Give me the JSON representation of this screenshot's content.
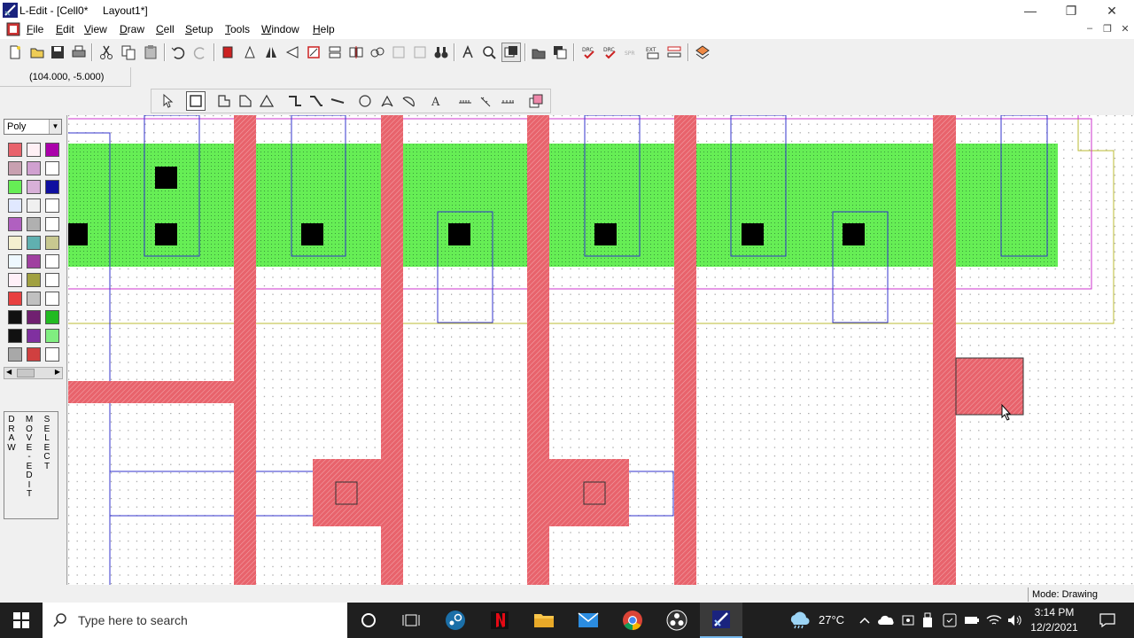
{
  "window": {
    "app_name": "L-Edit",
    "title": "L-Edit - [Cell0*     Layout1*]",
    "buttons": {
      "minimize": "—",
      "restore": "❐",
      "close": "✕"
    }
  },
  "menu": {
    "items": [
      {
        "label": "File",
        "mnemonic": "F"
      },
      {
        "label": "Edit",
        "mnemonic": "E"
      },
      {
        "label": "View",
        "mnemonic": "V"
      },
      {
        "label": "Draw",
        "mnemonic": "D"
      },
      {
        "label": "Cell",
        "mnemonic": "C"
      },
      {
        "label": "Setup",
        "mnemonic": "S"
      },
      {
        "label": "Tools",
        "mnemonic": "T"
      },
      {
        "label": "Window",
        "mnemonic": "W"
      },
      {
        "label": "Help",
        "mnemonic": "H"
      }
    ]
  },
  "toolbar": {
    "text_buttons": [
      "DRC",
      "DRC",
      "SPR",
      "EXT"
    ]
  },
  "cursor_readout": "(104.000, -5.000)",
  "layer_palette": {
    "selected_layer": "Poly",
    "modes": [
      "DRAW",
      "MOVE-EDIT",
      "SELECT"
    ]
  },
  "status": {
    "mode": "Mode: Drawing"
  },
  "taskbar": {
    "search_placeholder": "Type here to search",
    "temperature": "27°C",
    "time": "3:14 PM",
    "date": "12/2/2021"
  },
  "colors": {
    "poly": "#e8636c",
    "active": "#66ee55",
    "contact": "#000000",
    "metal_outline": "#3333cc",
    "well_outline": "#cc33cc",
    "select_outline": "#bbbb33"
  }
}
